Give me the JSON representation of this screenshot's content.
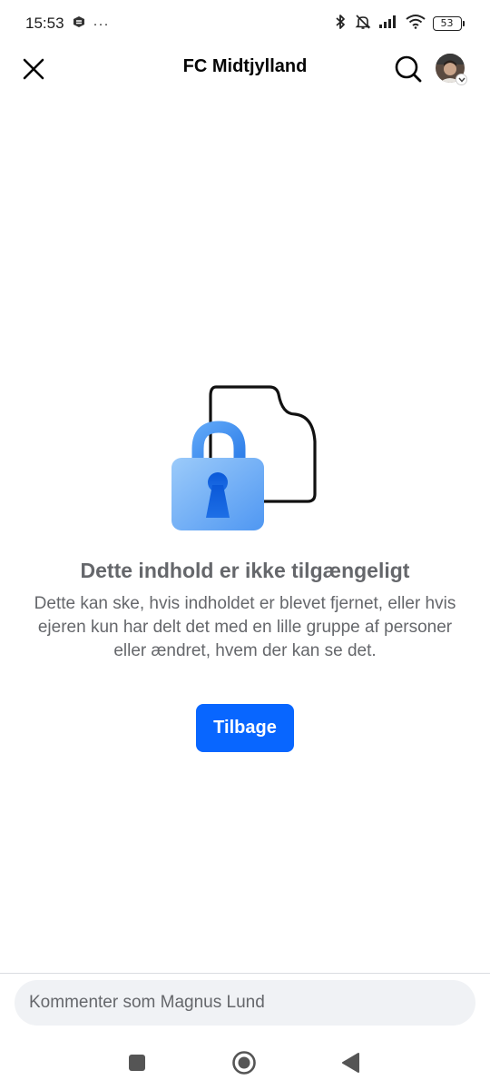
{
  "status_bar": {
    "time": "15:53",
    "overflow": "···",
    "battery_level": "53",
    "icons": [
      "app-notification-icon",
      "bluetooth-icon",
      "mute-icon",
      "signal-icon",
      "wifi-icon",
      "battery-icon"
    ]
  },
  "header": {
    "title": "FC Midtjylland",
    "icons": [
      "close-icon",
      "search-icon",
      "avatar"
    ]
  },
  "content": {
    "title": "Dette indhold er ikke tilgængeligt",
    "body": "Dette kan ske, hvis indholdet er blevet fjernet, eller hvis ejeren kun har delt det med en lille gruppe af personer eller ændret, hvem der kan se det.",
    "back_button_label": "Tilbage",
    "illustration": "lock-document-icon"
  },
  "comment": {
    "placeholder": "Kommenter som Magnus Lund"
  },
  "nav": {
    "icons": [
      "recents-square-icon",
      "home-circle-icon",
      "back-triangle-icon"
    ]
  },
  "colors": {
    "accent": "#0866ff",
    "secondary_text": "#65676b",
    "input_bg": "#f0f2f5",
    "lock_light": "#8ec0f7",
    "lock_dark": "#1a6fe8"
  }
}
